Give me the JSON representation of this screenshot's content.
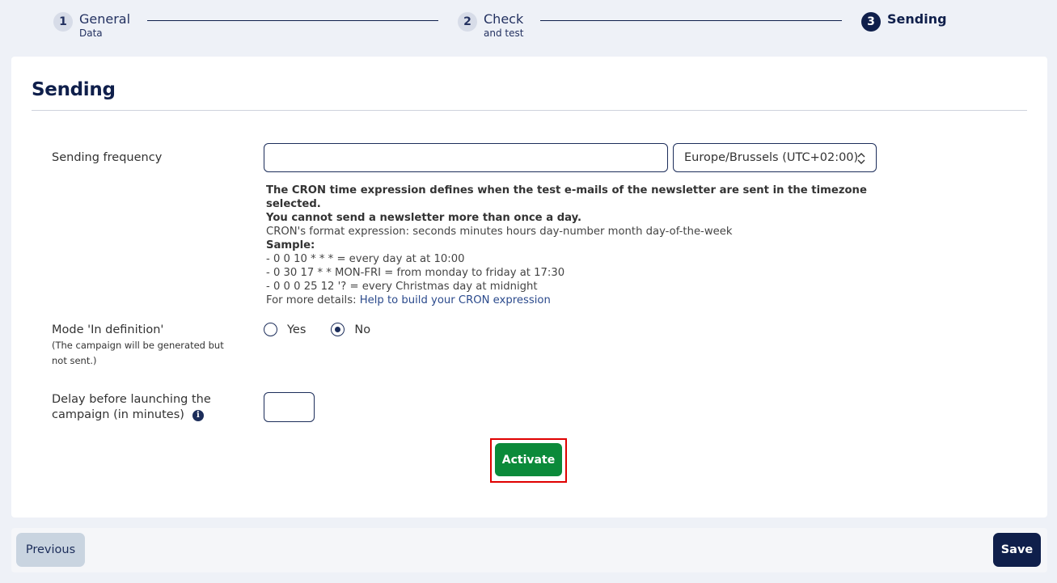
{
  "stepper": {
    "steps": [
      {
        "number": "1",
        "title": "General",
        "subtitle": "Data"
      },
      {
        "number": "2",
        "title": "Check",
        "subtitle": "and test"
      },
      {
        "number": "3",
        "title": "Sending",
        "subtitle": ""
      }
    ],
    "active_step": 3
  },
  "section": {
    "title": "Sending"
  },
  "sending_frequency": {
    "label": "Sending frequency",
    "input_value": "",
    "timezone": "Europe/Brussels (UTC+02:00)"
  },
  "help": {
    "line1": "The CRON time expression defines when the test e-mails of the newsletter are sent in the timezone selected.",
    "line2": "You cannot send a newsletter more than once a day.",
    "line3": "CRON's format expression: seconds minutes hours day-number month day-of-the-week",
    "sample_title": "Sample:",
    "samples": [
      "- 0 0 10 * * * = every day at at 10:00",
      "- 0 30 17 * * MON-FRI = from monday to friday at 17:30",
      "- 0 0 0 25 12 '? = every Christmas day at midnight"
    ],
    "details_prefix": "For more details: ",
    "details_link": "Help to build your CRON expression"
  },
  "mode": {
    "label": "Mode 'In definition'",
    "sublabel_line1": "(The campaign will be generated but",
    "sublabel_line2": "not sent.)",
    "options": [
      "Yes",
      "No"
    ],
    "selected": "No"
  },
  "delay": {
    "label_line1": "Delay before launching the",
    "label_line2": "campaign (in minutes)",
    "value": "",
    "info_glyph": "i"
  },
  "actions": {
    "activate": "Activate",
    "previous": "Previous",
    "save": "Save"
  },
  "colors": {
    "primary": "#0f1f4b",
    "activate": "#0b8a3a",
    "highlight": "#e00000",
    "background": "#eef1f7"
  }
}
